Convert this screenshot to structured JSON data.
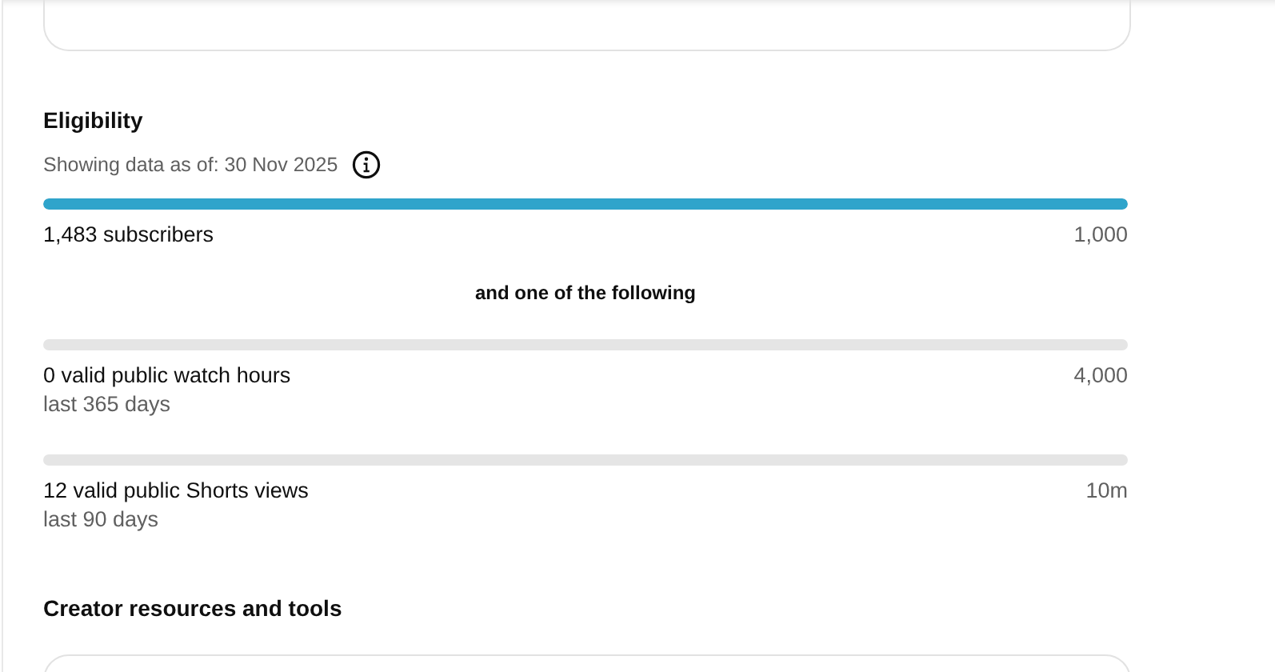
{
  "eligibility": {
    "title": "Eligibility",
    "as_of": "Showing data as of: 30 Nov 2025",
    "requirements": [
      {
        "label": "1,483 subscribers",
        "target": "1,000",
        "level": 1.0
      },
      {
        "label": "0 valid public watch hours",
        "period": "last 365 days",
        "target": "4,000",
        "level": 0
      },
      {
        "label": "12 valid public Shorts views",
        "period": "last 90 days",
        "target": "10m",
        "level": 0
      }
    ],
    "separator": "and one of the following"
  },
  "resources": {
    "title": "Creator resources and tools"
  }
}
